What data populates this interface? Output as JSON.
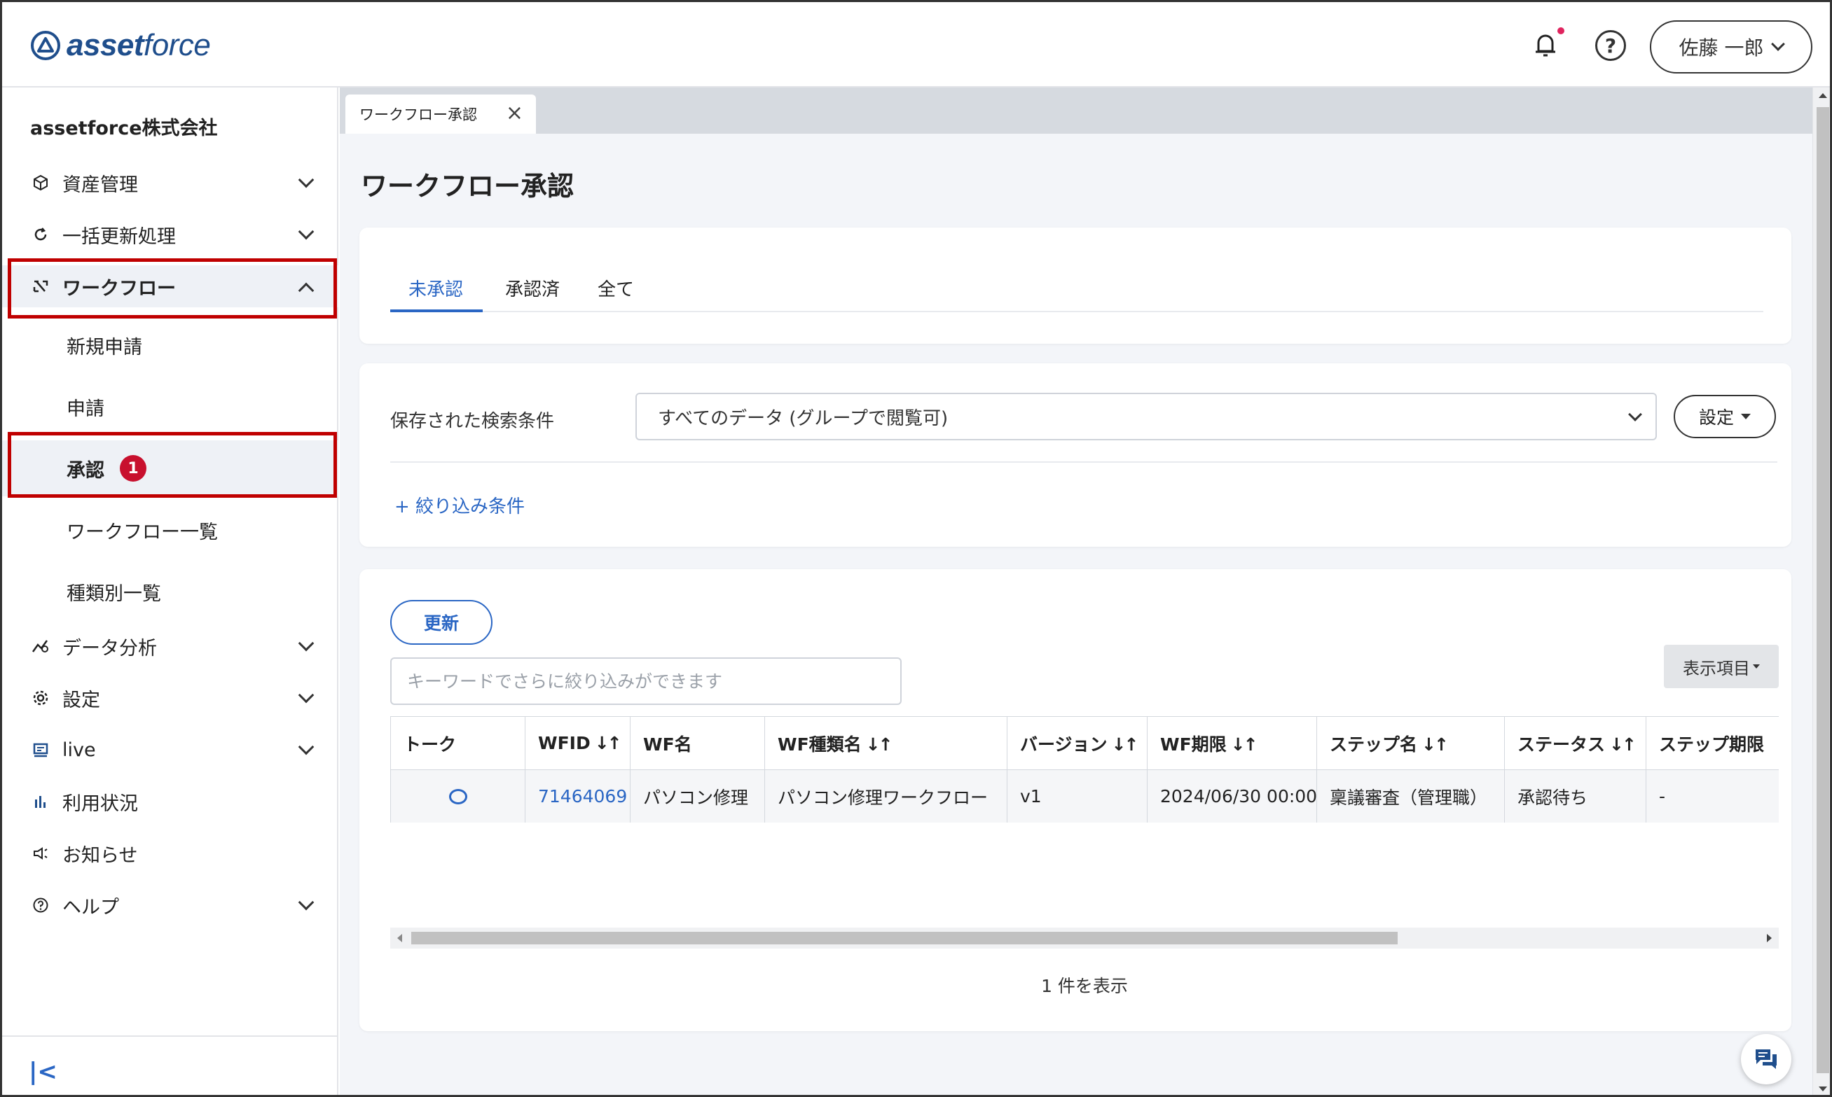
{
  "header": {
    "logo_text_bold": "asset",
    "logo_text_light": "force",
    "user_name": "佐藤 一郎",
    "help_glyph": "?",
    "icons": [
      "bell-icon",
      "help-icon",
      "chevron-down-icon"
    ],
    "notification_dot_color": "#e0245e"
  },
  "sidebar": {
    "company": "assetforce株式会社",
    "items": [
      {
        "label": "資産管理",
        "icon": "cube-icon"
      },
      {
        "label": "一括更新処理",
        "icon": "refresh-icon"
      },
      {
        "label": "ワークフロー",
        "icon": "workflow-icon"
      },
      {
        "label": "データ分析",
        "icon": "analytics-icon"
      },
      {
        "label": "設定",
        "icon": "gear-icon"
      },
      {
        "label": "live",
        "icon": "live-icon"
      },
      {
        "label": "利用状況",
        "icon": "bar-chart-icon"
      },
      {
        "label": "お知らせ",
        "icon": "megaphone-icon"
      },
      {
        "label": "ヘルプ",
        "icon": "help-circle-icon"
      }
    ],
    "workflow_sub": [
      {
        "label": "新規申請"
      },
      {
        "label": "申請"
      },
      {
        "label": "承認",
        "badge": "1"
      },
      {
        "label": "ワークフロー一覧"
      },
      {
        "label": "種類別一覧"
      }
    ],
    "collapse_glyph": "|<",
    "highlight_color": "#c00000"
  },
  "main": {
    "window_tab": "ワークフロー承認",
    "page_title": "ワークフロー承認",
    "tabs": [
      "未承認",
      "承認済",
      "全て"
    ],
    "active_tab": "未承認",
    "saved_search_label": "保存された検索条件",
    "saved_search_value": "すべてのデータ (グループで閲覧可)",
    "settings_label": "設定",
    "add_filter": "+ 絞り込み条件",
    "refresh_label": "更新",
    "keyword_placeholder": "キーワードでさらに絞り込みができます",
    "display_items_label": "表示項目",
    "table": {
      "headers": [
        "トーク",
        "WFID",
        "WF名",
        "WF種類名",
        "バージョン",
        "WF期限",
        "ステップ名",
        "ステータス",
        "ステップ期限"
      ],
      "sort_glyph": "↓↑",
      "rows": [
        [
          "",
          "71464069",
          "パソコン修理",
          "パソコン修理ワークフロー",
          "v1",
          "2024/06/30 00:00",
          "稟議審査（管理職）",
          "承認待ち",
          "-"
        ]
      ]
    },
    "count_text": "1 件を表示",
    "accent_color": "#2a66c4"
  }
}
